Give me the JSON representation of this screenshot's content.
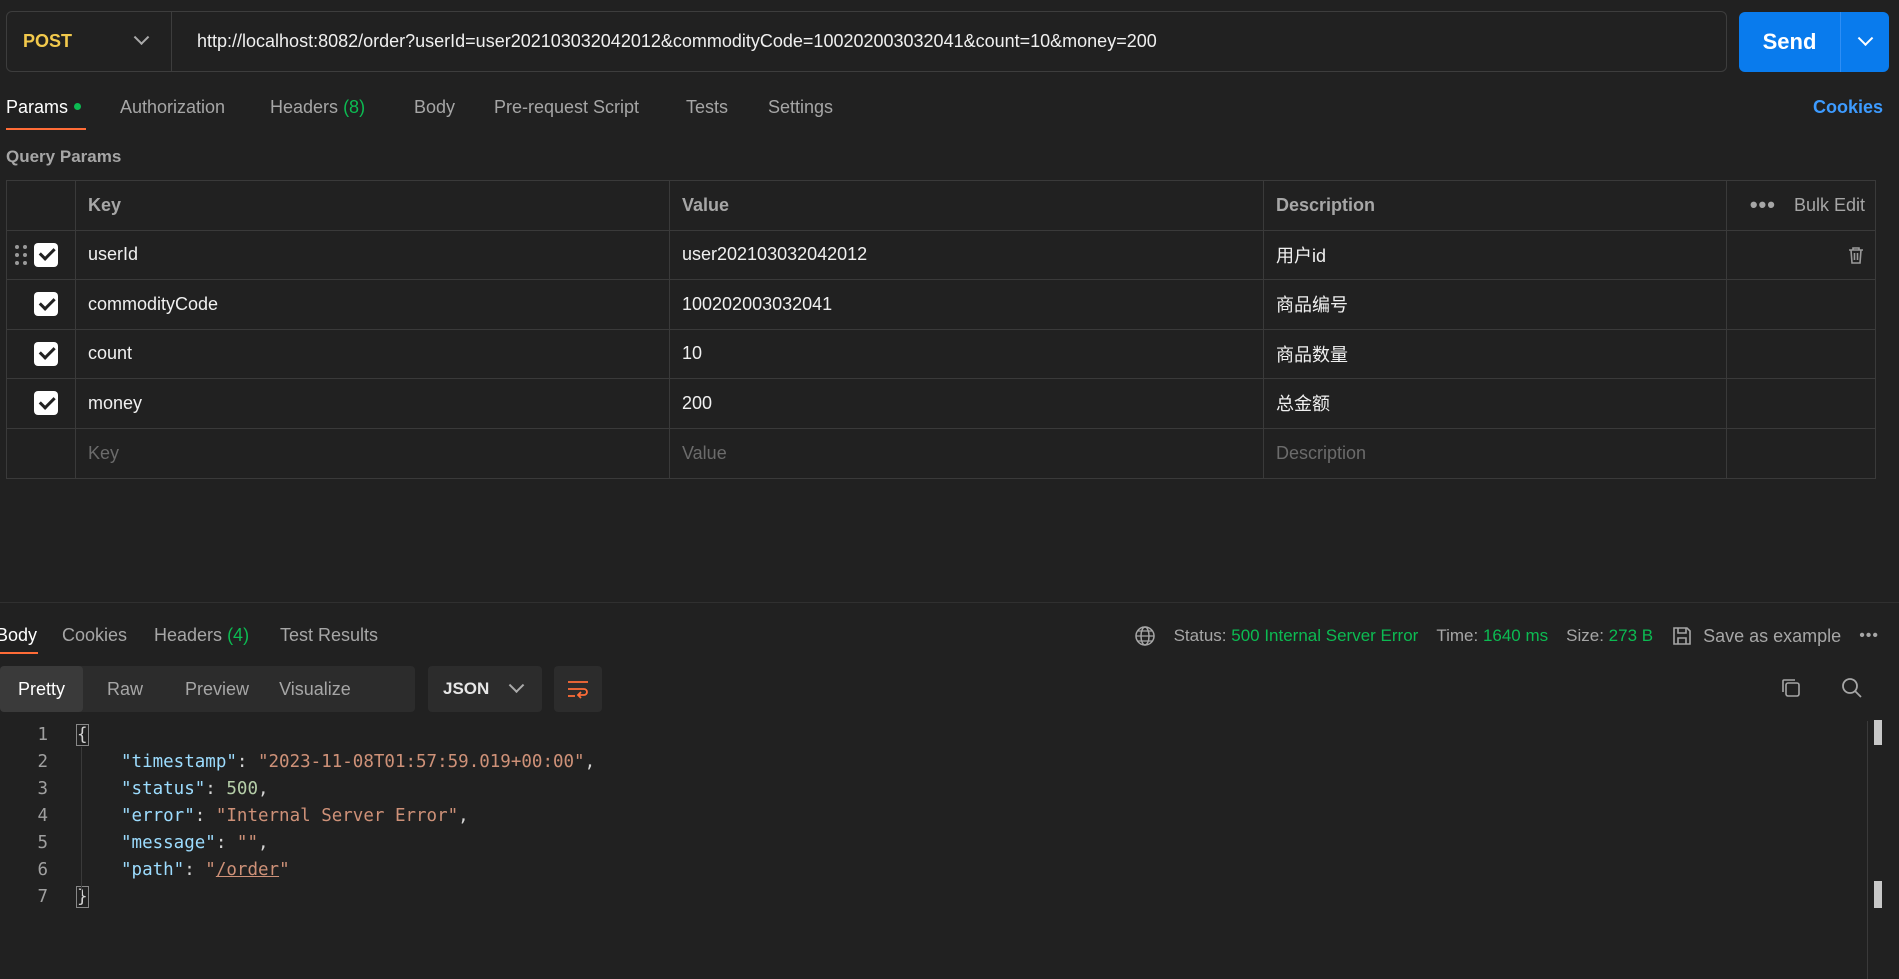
{
  "request": {
    "method": "POST",
    "url": "http://localhost:8082/order?userId=user202103032042012&commodityCode=100202003032041&count=10&money=200",
    "send_label": "Send"
  },
  "request_tabs": {
    "params": "Params",
    "authorization": "Authorization",
    "headers": "Headers",
    "headers_count": "(8)",
    "body": "Body",
    "prerequest": "Pre-request Script",
    "tests": "Tests",
    "settings": "Settings",
    "cookies": "Cookies"
  },
  "query_params": {
    "title": "Query Params",
    "headers": {
      "key": "Key",
      "value": "Value",
      "description": "Description",
      "bulk_edit": "Bulk Edit"
    },
    "rows": [
      {
        "key": "userId",
        "value": "user202103032042012",
        "description": "用户id"
      },
      {
        "key": "commodityCode",
        "value": "100202003032041",
        "description": "商品编号"
      },
      {
        "key": "count",
        "value": "10",
        "description": "商品数量"
      },
      {
        "key": "money",
        "value": "200",
        "description": "总金额"
      }
    ],
    "placeholders": {
      "key": "Key",
      "value": "Value",
      "description": "Description"
    }
  },
  "response_tabs": {
    "body": "Body",
    "cookies": "Cookies",
    "headers": "Headers",
    "headers_count": "(4)",
    "test_results": "Test Results"
  },
  "response_status": {
    "status_label": "Status:",
    "status_value": "500 Internal Server Error",
    "time_label": "Time:",
    "time_value": "1640 ms",
    "size_label": "Size:",
    "size_value": "273 B",
    "save_example": "Save as example"
  },
  "view_modes": {
    "pretty": "Pretty",
    "raw": "Raw",
    "preview": "Preview",
    "visualize": "Visualize",
    "format": "JSON"
  },
  "code_lines": [
    "1",
    "2",
    "3",
    "4",
    "5",
    "6",
    "7"
  ],
  "json_body": {
    "open": "{",
    "close": "}",
    "timestamp_key": "\"timestamp\"",
    "timestamp_val": "\"2023-11-08T01:57:59.019+00:00\"",
    "status_key": "\"status\"",
    "status_val": "500",
    "error_key": "\"error\"",
    "error_val": "\"Internal Server Error\"",
    "message_key": "\"message\"",
    "message_val": "\"\"",
    "path_key": "\"path\"",
    "path_q": "\"",
    "path_val": "/order"
  },
  "colors": {
    "accent": "#ff6c37",
    "send": "#097bed",
    "success": "#0cbb52",
    "method": "#f2c94c",
    "link": "#3d9bff"
  }
}
